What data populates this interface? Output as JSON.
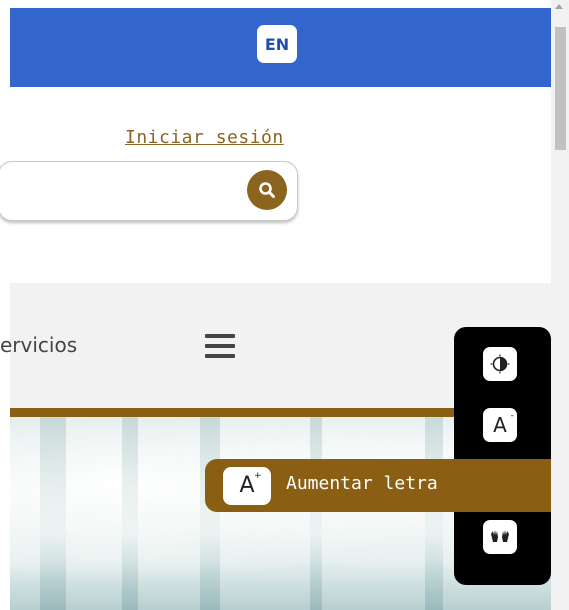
{
  "header": {
    "language_button": "EN",
    "login_link": "Iniciar sesión"
  },
  "search": {
    "placeholder": "",
    "button_icon": "search-icon"
  },
  "nav": {
    "partial_label": "ervicios",
    "menu_icon": "hamburger-menu-icon"
  },
  "accessibility": {
    "contrast_icon": "contrast-icon",
    "decrease_label": "A",
    "decrease_sign": "-",
    "increase_label": "A",
    "increase_sign": "+",
    "increase_tooltip": "Aumentar letra",
    "sign_language_icon": "sign-language-icon"
  },
  "colors": {
    "header_blue": "#3366cc",
    "brand_gold": "#8a5f13",
    "panel_black": "#000000"
  }
}
